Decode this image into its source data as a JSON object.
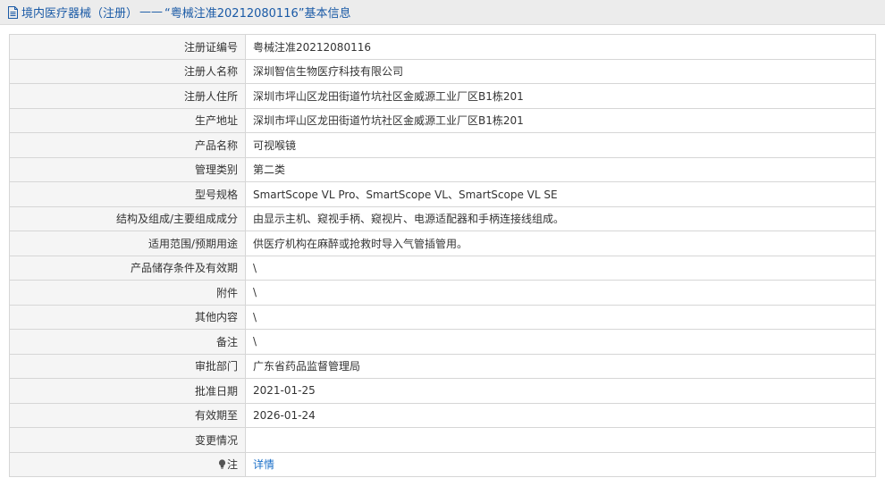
{
  "header": {
    "category": "境内医疗器械（注册）",
    "separator": "——",
    "title": "“粤械注准20212080116”基本信息",
    "icon": "document-icon",
    "color": "#1a5aa6"
  },
  "rows": [
    {
      "label": "注册证编号",
      "value": "粤械注准20212080116"
    },
    {
      "label": "注册人名称",
      "value": "深圳智信生物医疗科技有限公司"
    },
    {
      "label": "注册人住所",
      "value": "深圳市坪山区龙田街道竹坑社区金威源工业厂区B1栋201"
    },
    {
      "label": "生产地址",
      "value": "深圳市坪山区龙田街道竹坑社区金威源工业厂区B1栋201"
    },
    {
      "label": "产品名称",
      "value": "可视喉镜"
    },
    {
      "label": "管理类别",
      "value": "第二类"
    },
    {
      "label": "型号规格",
      "value": "SmartScope VL Pro、SmartScope VL、SmartScope VL SE"
    },
    {
      "label": "结构及组成/主要组成成分",
      "value": "由显示主机、窥视手柄、窥视片、电源适配器和手柄连接线组成。"
    },
    {
      "label": "适用范围/预期用途",
      "value": "供医疗机构在麻醉或抢救时导入气管插管用。"
    },
    {
      "label": "产品储存条件及有效期",
      "value": "\\"
    },
    {
      "label": "附件",
      "value": "\\"
    },
    {
      "label": "其他内容",
      "value": "\\"
    },
    {
      "label": "备注",
      "value": "\\"
    },
    {
      "label": "审批部门",
      "value": "广东省药品监督管理局"
    },
    {
      "label": "批准日期",
      "value": "2021-01-25"
    },
    {
      "label": "有效期至",
      "value": "2026-01-24"
    },
    {
      "label": "变更情况",
      "value": ""
    }
  ],
  "note_row": {
    "label": "注",
    "icon": "lightbulb-icon",
    "link_text": "详情",
    "link_color": "#1a6fc8"
  }
}
